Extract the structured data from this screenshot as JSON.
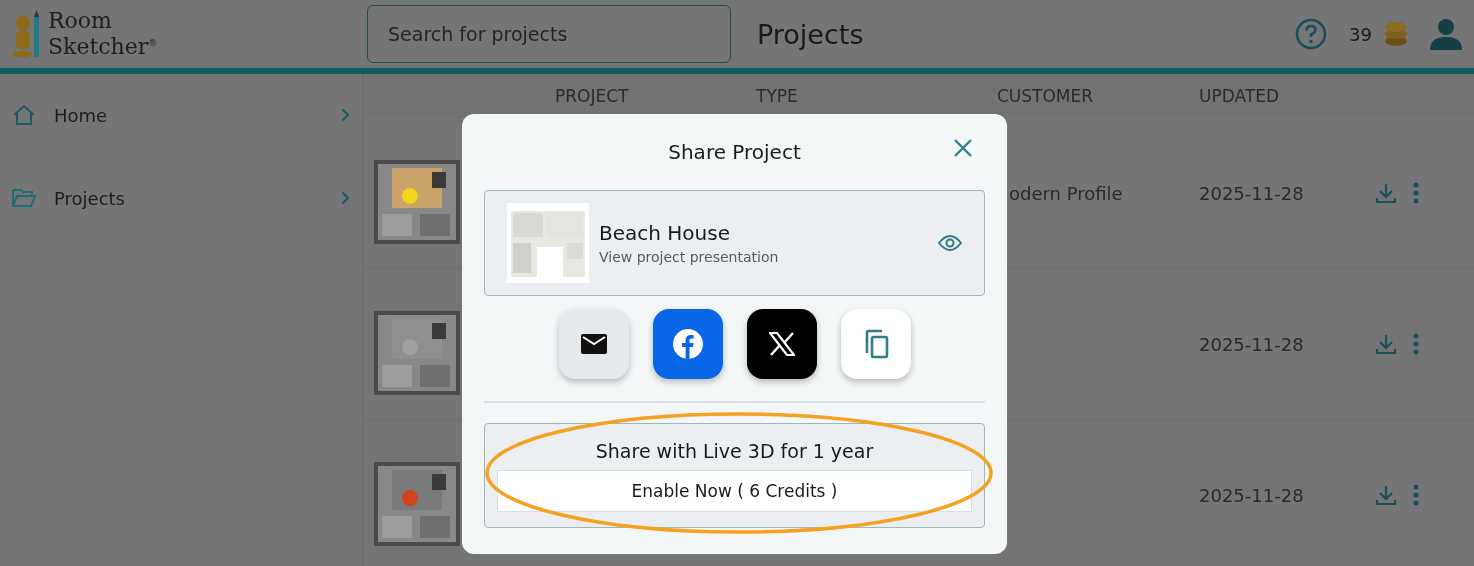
{
  "logo": {
    "line1": "Room",
    "line2": "Sketcher",
    "mark": "®"
  },
  "search": {
    "placeholder": "Search for projects"
  },
  "page_title": "Projects",
  "credits": "39",
  "sidebar": {
    "items": [
      {
        "label": "Home",
        "kind": "home"
      },
      {
        "label": "Projects",
        "kind": "folder"
      }
    ]
  },
  "table": {
    "columns": [
      "PROJECT",
      "TYPE",
      "CUSTOMER",
      "UPDATED"
    ],
    "rows": [
      {
        "customer": "odern Profile",
        "updated": "2025-11-28"
      },
      {
        "updated": "2025-11-28"
      },
      {
        "updated": "2025-11-28"
      }
    ]
  },
  "dialog": {
    "title": "Share Project",
    "project": {
      "name": "Beach House",
      "subtitle": "View project presentation"
    },
    "share_buttons": [
      {
        "kind": "email"
      },
      {
        "kind": "facebook"
      },
      {
        "kind": "x"
      },
      {
        "kind": "copy"
      }
    ],
    "live3d": {
      "title": "Share with Live 3D for 1 year",
      "button": "Enable Now ( 6 Credits )"
    }
  }
}
